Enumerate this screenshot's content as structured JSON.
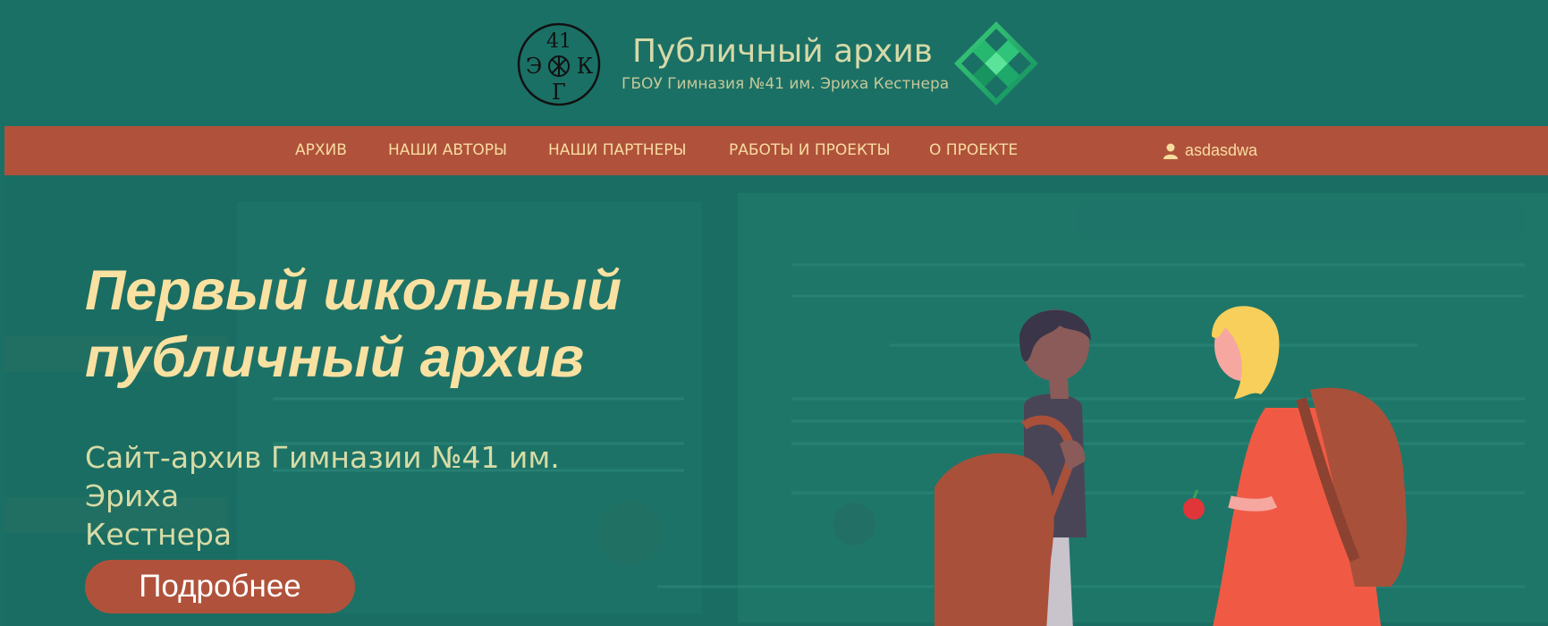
{
  "header": {
    "left_logo": {
      "top": "41",
      "left": "Э",
      "right": "К",
      "bottom": "Г"
    },
    "title": "Публичный архив",
    "subtitle": "ГБОУ Гимназия №41 им. Эриха Кестнера"
  },
  "nav": {
    "items": [
      {
        "label": "АРХИВ"
      },
      {
        "label": "НАШИ АВТОРЫ"
      },
      {
        "label": "НАШИ ПАРТНЕРЫ"
      },
      {
        "label": "РАБОТЫ И ПРОЕКТЫ"
      },
      {
        "label": "О ПРОЕКТЕ"
      }
    ],
    "user": {
      "icon": "user-icon",
      "name": "asdasdwa"
    }
  },
  "hero": {
    "heading_line1": "Первый школьный",
    "heading_line2": "публичный архив",
    "subtitle_line1": "Сайт-архив Гимназии №41 им. Эриха",
    "subtitle_line2": "Кестнера",
    "cta_label": "Подробнее"
  },
  "colors": {
    "header_bg": "#1b7065",
    "nav_bg": "#b0523b",
    "nav_text": "#f7dca0",
    "hero_heading": "#f9e1a1",
    "hero_subtitle": "#d6dba6",
    "button_bg": "#b0523b"
  }
}
